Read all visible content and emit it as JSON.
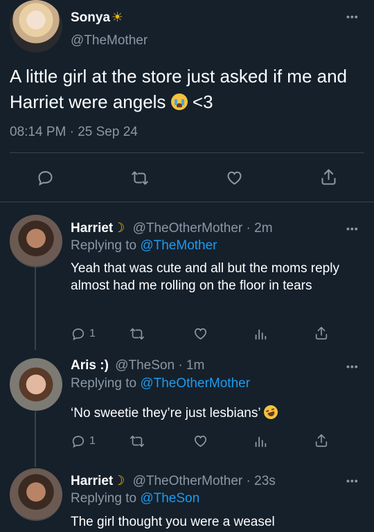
{
  "main_tweet": {
    "name": "Sonya",
    "name_emoji": "☀",
    "handle": "@TheMother",
    "text": "A little girl at the store just asked if me and Harriet were angels",
    "text_suffix": "<3",
    "timestamp": "08:14 PM · 25 Sep 24",
    "more": "•••"
  },
  "replies": [
    {
      "name": "Harriet",
      "name_emoji": "☽",
      "handle": "@TheOtherMother",
      "time": "· 2m",
      "replying_label": "Replying to",
      "replying_to": "@TheMother",
      "text": "Yeah that was cute and all but the moms reply almost had me rolling on the floor in tears",
      "reply_count": "1",
      "more": "•••"
    },
    {
      "name": "Aris :)",
      "handle": "@TheSon",
      "time": "· 1m",
      "replying_label": "Replying to",
      "replying_to": "@TheOtherMother",
      "text": "‘No sweetie they’re just lesbians’",
      "reply_count": "1",
      "more": "•••"
    },
    {
      "name": "Harriet",
      "name_emoji": "☽",
      "handle": "@TheOtherMother",
      "time": "· 23s",
      "replying_label": "Replying to",
      "replying_to": "@TheSon",
      "text": "The girl thought you were a weasel",
      "more": "•••"
    }
  ],
  "colors": {
    "background": "#15202b",
    "text": "#ffffff",
    "muted": "#8b98a5",
    "link": "#1d9bf0",
    "divider": "#38444d",
    "emoji_sun": "#f5b400",
    "emoji_moon": "#f5b400"
  },
  "icons": [
    "reply-icon",
    "retweet-icon",
    "like-icon",
    "share-icon",
    "analytics-icon",
    "more-icon",
    "crying-emoji-icon",
    "laughing-emoji-icon"
  ]
}
